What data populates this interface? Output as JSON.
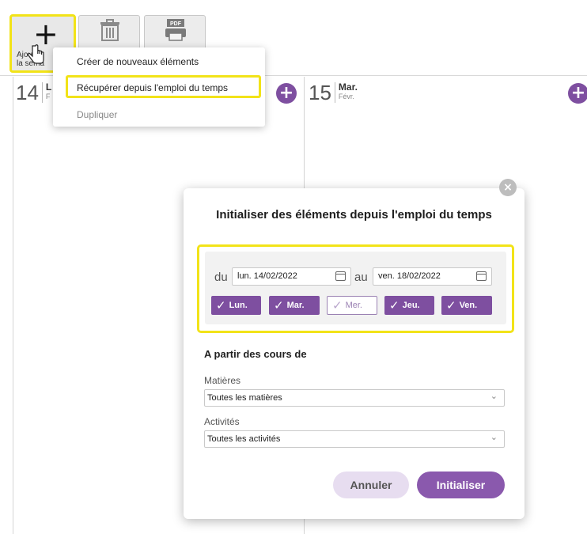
{
  "toolbar": {
    "add_label_line1": "Ajouter",
    "add_label_line2": "la sema",
    "add_glyph": "+",
    "pdf_label": "PDF",
    "icons": [
      "plus-icon",
      "trash-icon",
      "printer-pdf-icon"
    ]
  },
  "menu": {
    "items": [
      {
        "label": "Créer de nouveaux éléments"
      },
      {
        "label": "Récupérer depuis l'emploi du temps"
      },
      {
        "label": "Dupliquer"
      }
    ]
  },
  "calendar": {
    "days": [
      {
        "number": "14",
        "name": "L",
        "month": "F"
      },
      {
        "number": "15",
        "name": "Mar.",
        "month": "Févr."
      }
    ],
    "add_glyph": "+"
  },
  "dialog": {
    "title": "Initialiser des éléments depuis l'emploi du temps",
    "close_glyph": "×",
    "from_label": "du",
    "to_label": "au",
    "from_date": "lun. 14/02/2022",
    "to_date": "ven. 18/02/2022",
    "weekdays": [
      {
        "label": "Lun.",
        "checked": true
      },
      {
        "label": "Mar.",
        "checked": true
      },
      {
        "label": "Mer.",
        "checked": false
      },
      {
        "label": "Jeu.",
        "checked": true
      },
      {
        "label": "Ven.",
        "checked": true
      }
    ],
    "section_title": "A partir des cours de",
    "subjects_label": "Matières",
    "subjects_value": "Toutes les matières",
    "activities_label": "Activités",
    "activities_value": "Toutes les activités",
    "cancel_label": "Annuler",
    "submit_label": "Initialiser"
  },
  "colors": {
    "accent": "#7e4fa0",
    "highlight": "#f2e318",
    "cancel_bg": "#e7ddf0"
  }
}
